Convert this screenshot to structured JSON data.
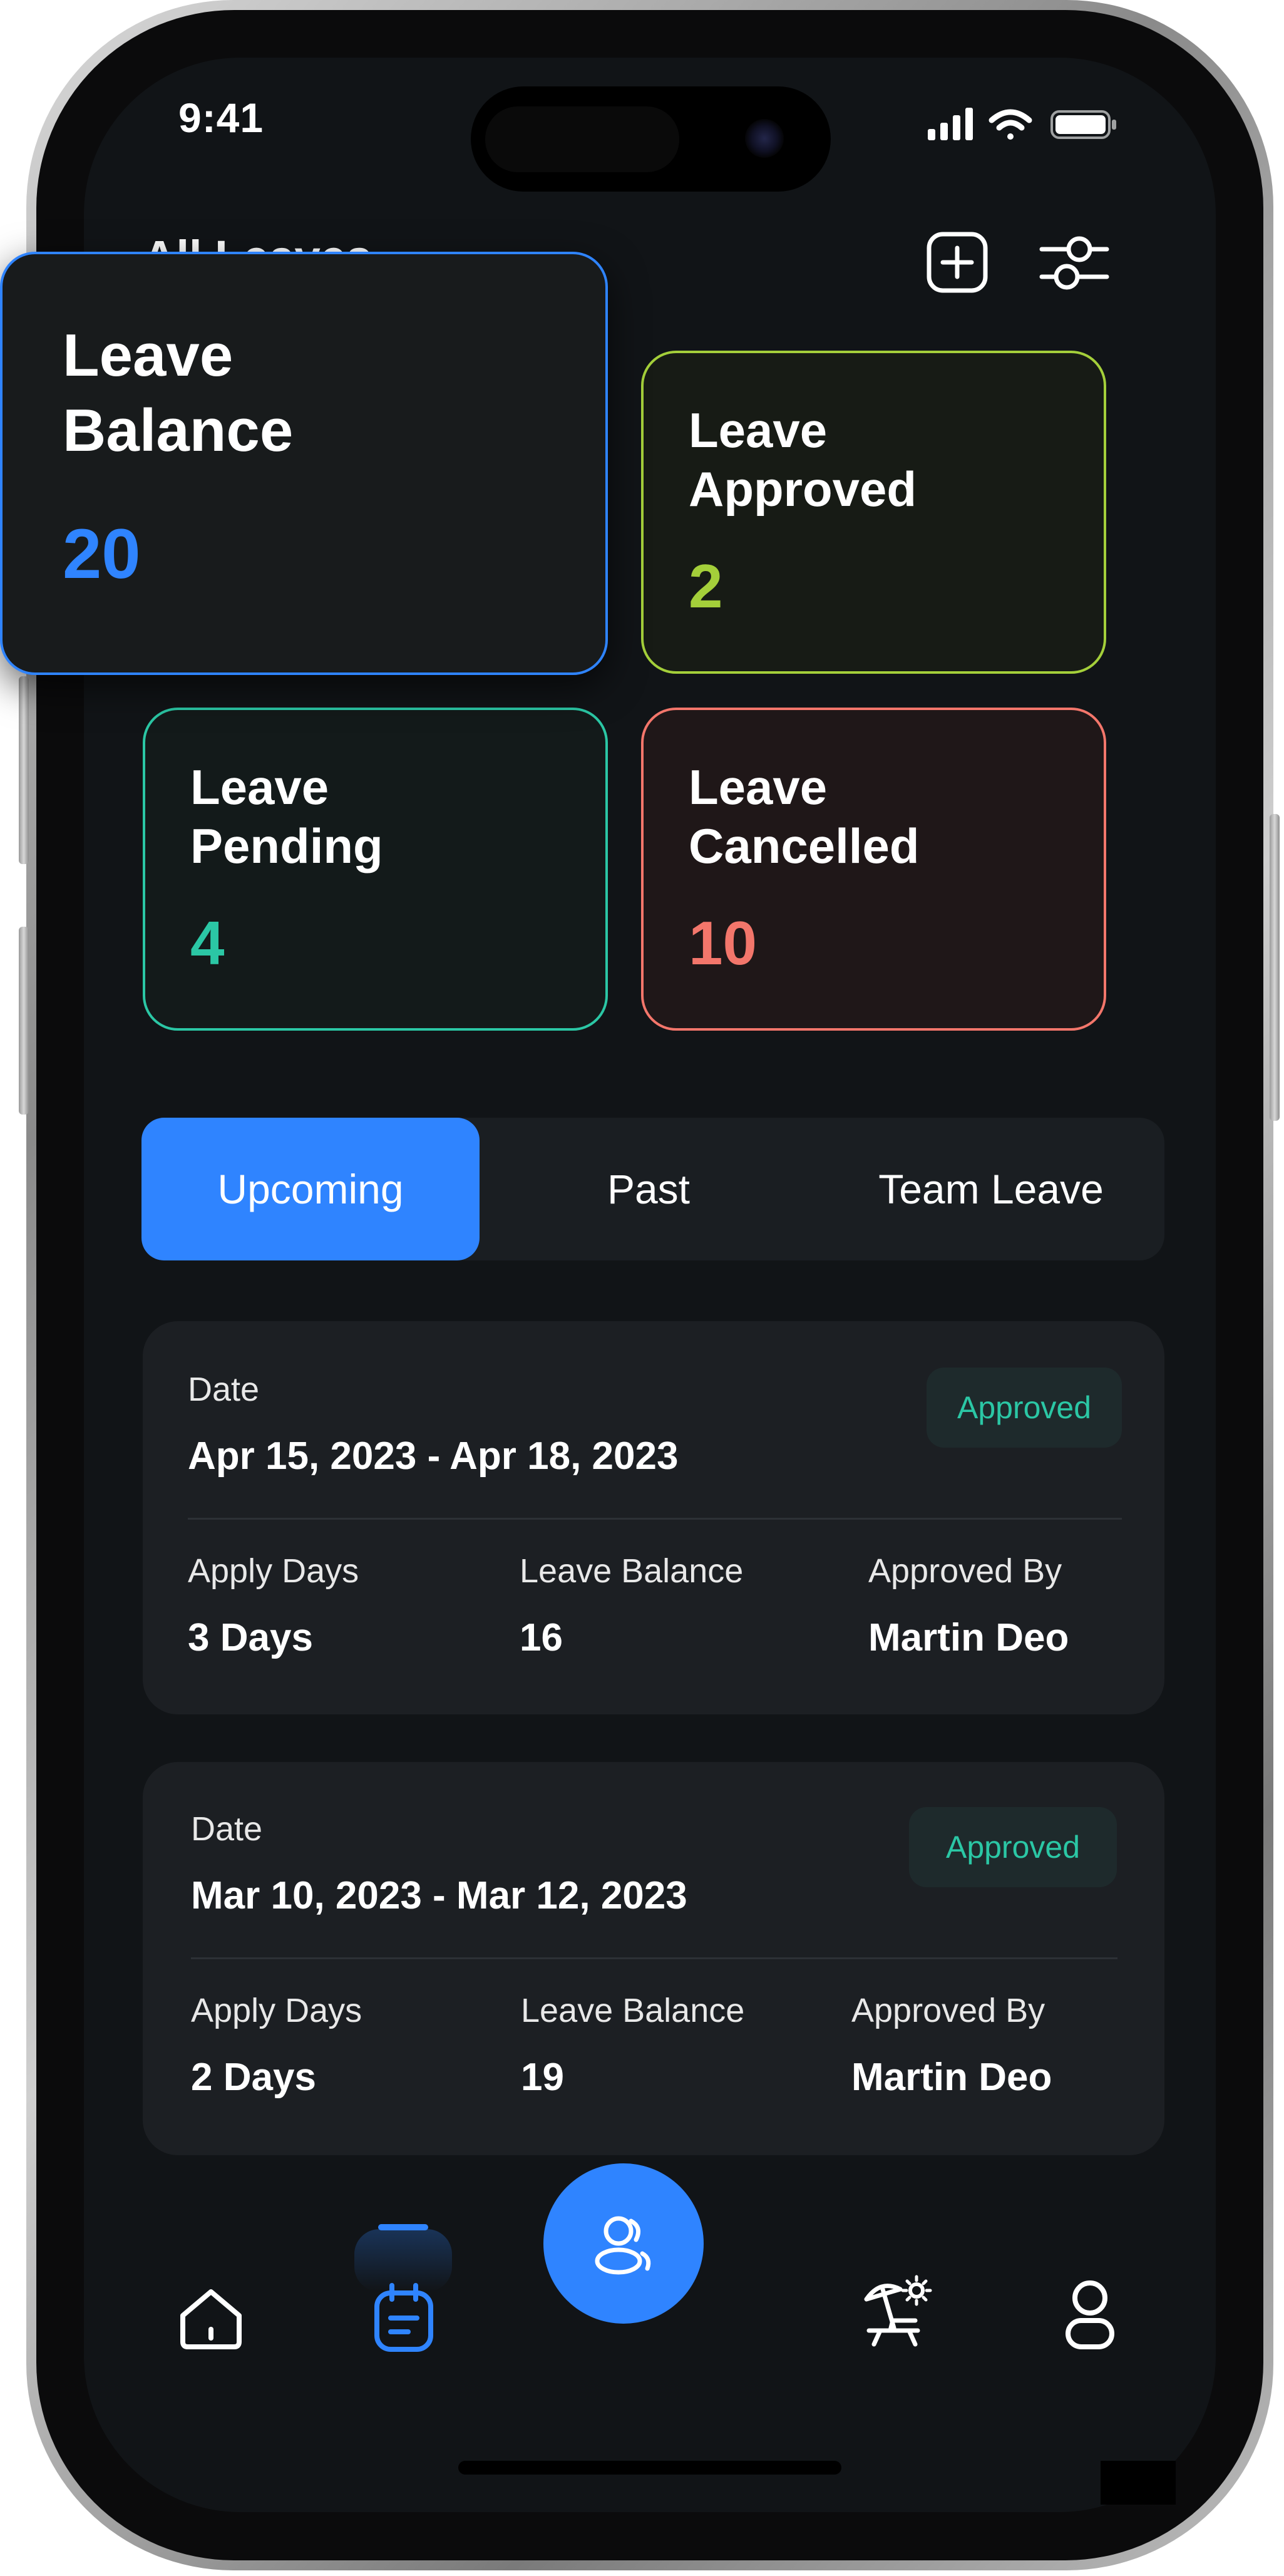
{
  "status_bar": {
    "time": "9:41"
  },
  "header": {
    "title_partial": "All Leaves"
  },
  "summary_cards": [
    {
      "title_line1": "Leave",
      "title_line2": "Balance",
      "value": "20",
      "color": "#2f84ff"
    },
    {
      "title_line1": "Leave",
      "title_line2": "Approved",
      "value": "2",
      "color": "#a4cf3a"
    },
    {
      "title_line1": "Leave",
      "title_line2": "Pending",
      "value": "4",
      "color": "#2bc7a5"
    },
    {
      "title_line1": "Leave",
      "title_line2": "Cancelled",
      "value": "10",
      "color": "#f3766b"
    }
  ],
  "tabs": [
    "Upcoming",
    "Past",
    "Team Leave"
  ],
  "active_tab": "Upcoming",
  "leaves": [
    {
      "date_label": "Date",
      "date_range": "Apr 15, 2023 - Apr 18, 2023",
      "status": "Approved",
      "apply_days_label": "Apply Days",
      "apply_days": "3 Days",
      "balance_label": "Leave Balance",
      "balance": "16",
      "approved_by_label": "Approved By",
      "approved_by": "Martin Deo"
    },
    {
      "date_label": "Date",
      "date_range": "Mar 10, 2023 - Mar 12, 2023",
      "status": "Approved",
      "apply_days_label": "Apply Days",
      "apply_days": "2 Days",
      "balance_label": "Leave Balance",
      "balance": "19",
      "approved_by_label": "Approved By",
      "approved_by": "Martin Deo"
    }
  ],
  "bottom_nav": {
    "items": [
      "home-icon",
      "calendar-icon",
      "team-icon",
      "holiday-icon",
      "profile-icon"
    ],
    "active": "calendar-icon",
    "accent": "#2f84ff"
  },
  "colors": {
    "background": "#111417",
    "card": "#1c1f23",
    "accent": "#2f84ff"
  }
}
